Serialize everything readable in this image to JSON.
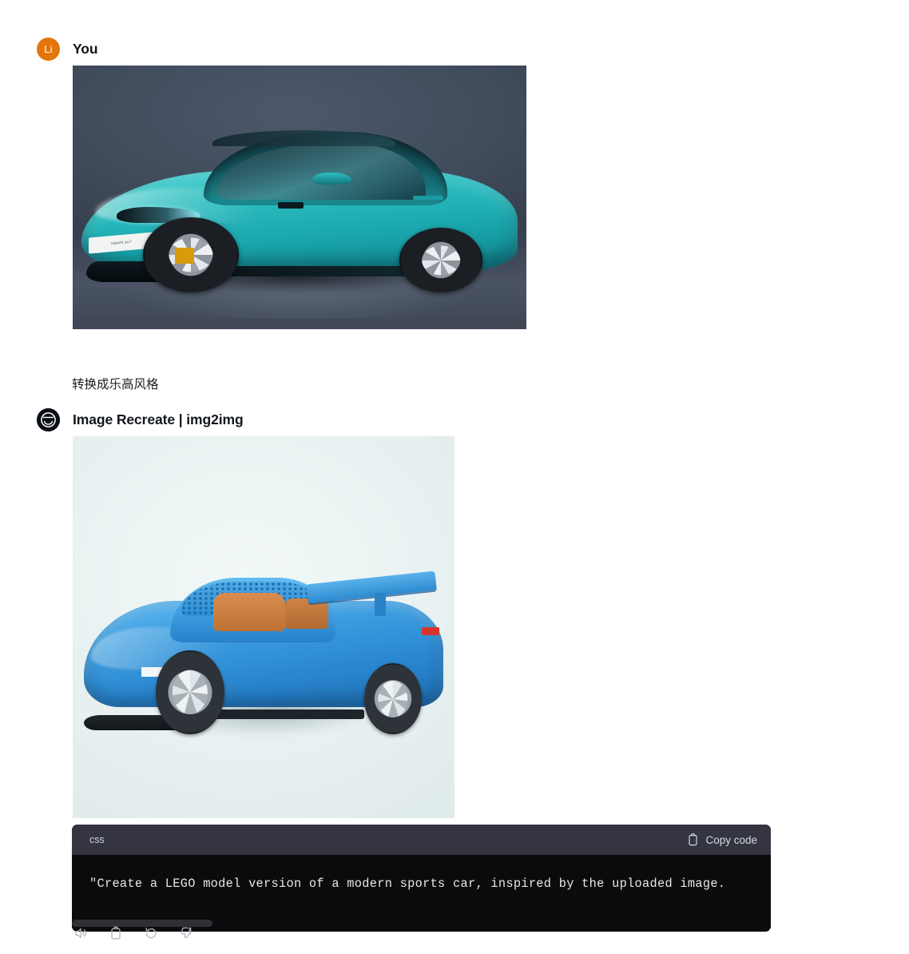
{
  "conversation": {
    "user_message": {
      "author": "You",
      "avatar_initials": "Li",
      "avatar_color": "#e2750b",
      "attachment": {
        "name": "uploaded-car-photo",
        "alt": "Teal Xiaomi SU7 electric sedan on a gray studio background",
        "license_plate": "xiaomi su7",
        "car_color": "#2bbdc0",
        "background_color": "#3e4858"
      },
      "text": "转换成乐高风格"
    },
    "assistant_message": {
      "author": "Image Recreate | img2img",
      "avatar_icon": "img2img-logo-icon",
      "avatar_color": "#0b0f14",
      "attachment": {
        "name": "generated-lego-car-image",
        "alt": "Blue LEGO brick model of a modern sports car on a pale mint background",
        "car_color": "#3d9de0",
        "background_color": "#e8f1f1"
      },
      "code_block": {
        "language": "css",
        "copy_label": "Copy code",
        "copy_icon": "clipboard-icon",
        "code": "\"Create a LEGO model version of a modern sports car, inspired by the uploaded image."
      },
      "actions": [
        {
          "name": "read-aloud",
          "icon": "speaker-icon"
        },
        {
          "name": "copy",
          "icon": "clipboard-icon"
        },
        {
          "name": "regenerate",
          "icon": "rotate-ccw-icon"
        },
        {
          "name": "dislike",
          "icon": "thumbs-down-icon"
        }
      ]
    }
  }
}
